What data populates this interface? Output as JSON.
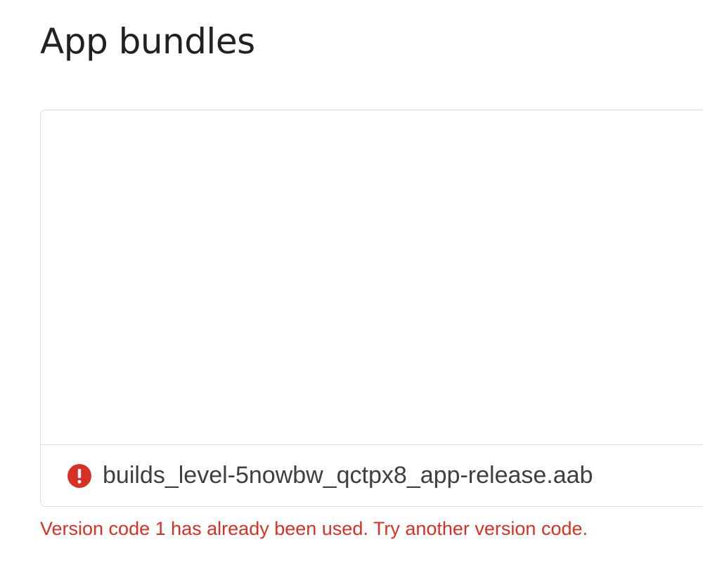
{
  "page": {
    "title": "App bundles"
  },
  "upload": {
    "file_name": "builds_level-5nowbw_qctpx8_app-release.aab",
    "status_icon": "error-icon",
    "error_message": "Version code 1 has already been used. Try another version code."
  },
  "colors": {
    "error": "#d93025",
    "border": "#dadce0",
    "text_primary": "#202124",
    "text_secondary": "#3c4043"
  }
}
